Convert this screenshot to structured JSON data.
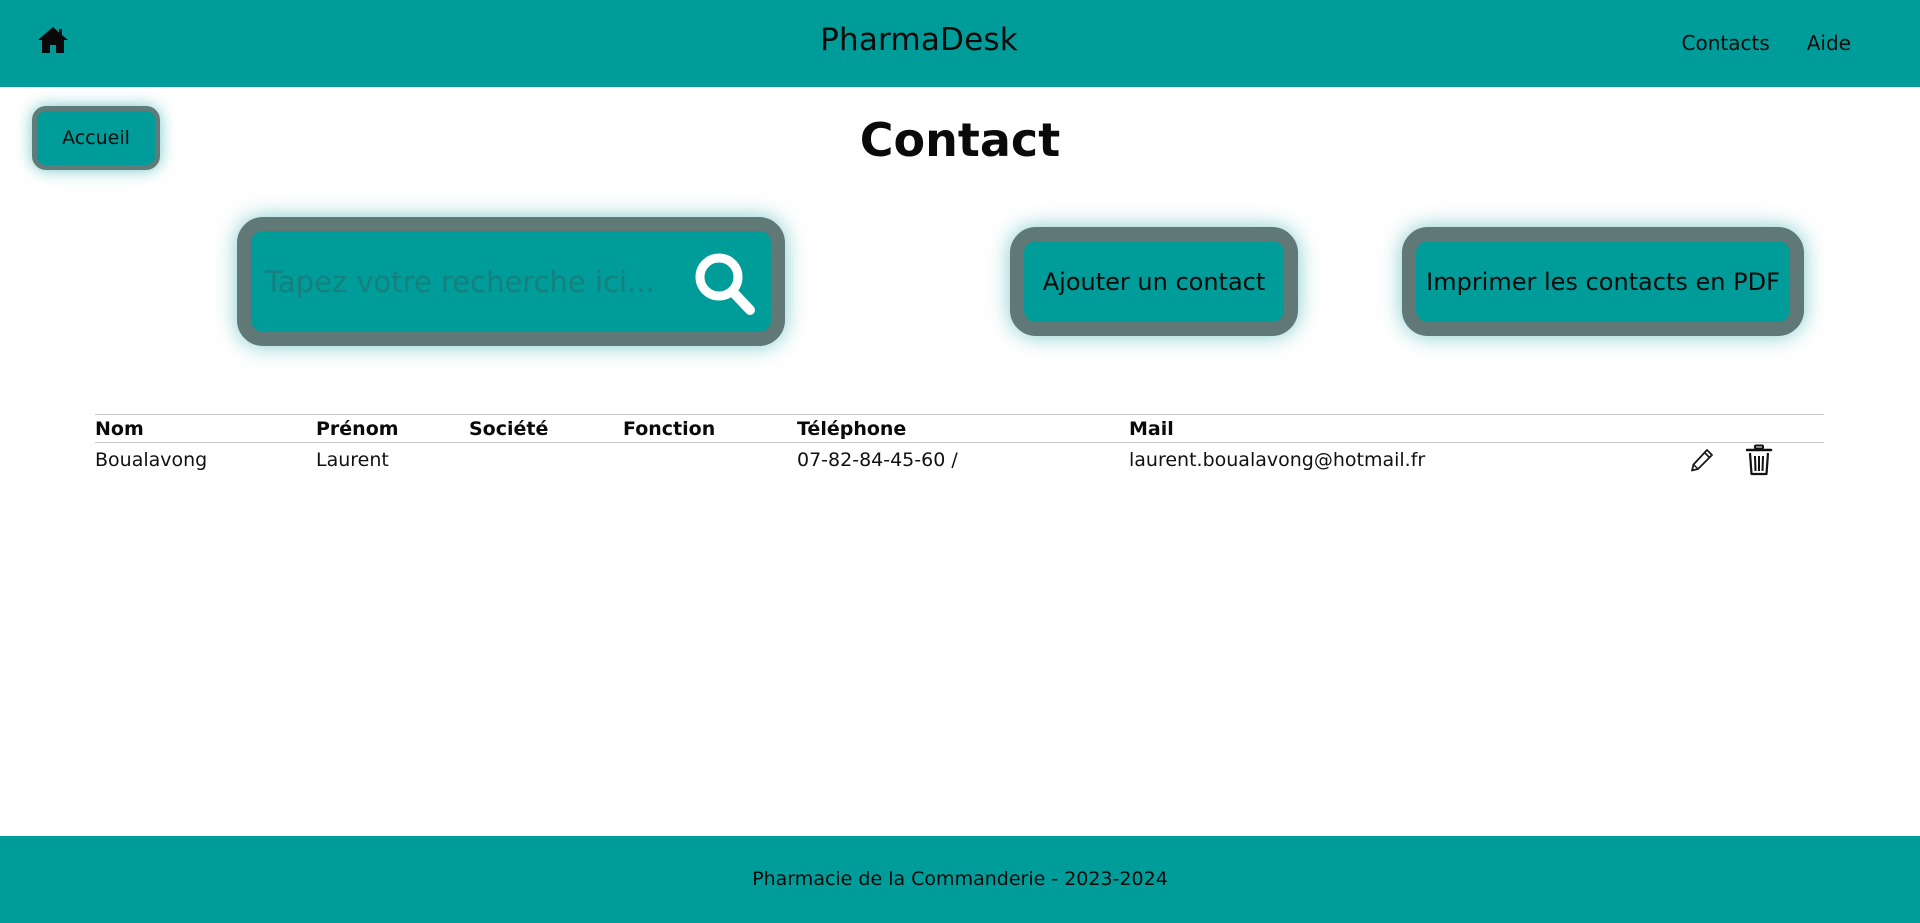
{
  "header": {
    "app_title": "PharmaDesk",
    "nav": [
      {
        "label": "Contacts"
      },
      {
        "label": "Aide"
      }
    ]
  },
  "home_button_label": "Accueil",
  "page_title": "Contact",
  "search": {
    "placeholder": "Tapez votre recherche ici...",
    "value": ""
  },
  "actions": {
    "add_label": "Ajouter un contact",
    "pdf_label": "Imprimer les contacts en PDF"
  },
  "table": {
    "columns": [
      "Nom",
      "Prénom",
      "Société",
      "Fonction",
      "Téléphone",
      "Mail"
    ],
    "rows": [
      {
        "nom": "Boualavong",
        "prenom": "Laurent",
        "societe": "",
        "fonction": "",
        "telephone": "07-82-84-45-60 /",
        "mail": "laurent.boualavong@hotmail.fr"
      }
    ]
  },
  "footer": {
    "text": "Pharmacie de la Commanderie - 2023-2024"
  },
  "colors": {
    "primary": "#009c99",
    "border": "#607876"
  },
  "icons": [
    "home-icon",
    "search-icon",
    "edit-icon",
    "delete-icon"
  ]
}
